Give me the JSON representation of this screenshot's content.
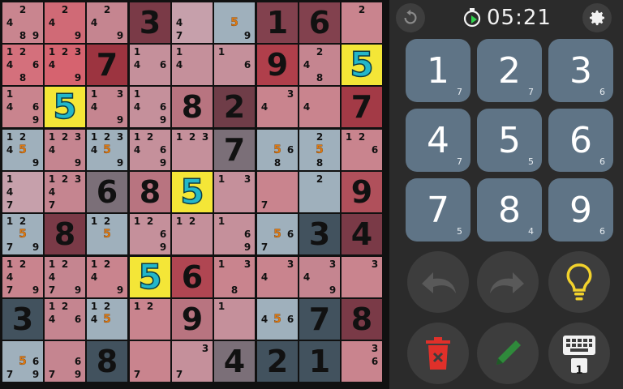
{
  "board": {
    "cells": [
      [
        {
          "n": "",
          "m": "2489",
          "c": "#c9858f"
        },
        {
          "n": "",
          "m": "249",
          "c": "#d06a76"
        },
        {
          "n": "",
          "m": "249",
          "c": "#c58590"
        },
        {
          "n": "3",
          "c": "#7a3a47"
        },
        {
          "n": "",
          "m": "47",
          "c": "#c6a0ab"
        },
        {
          "n": "",
          "m": "59",
          "c": "#9fb0bc"
        },
        {
          "n": "1",
          "c": "#82414e"
        },
        {
          "n": "6",
          "c": "#82414e"
        },
        {
          "n": "",
          "m": "2",
          "c": "#c9848e"
        }
      ],
      [
        {
          "n": "",
          "m": "12468",
          "c": "#d4707c"
        },
        {
          "n": "",
          "m": "12349",
          "c": "#d6636f"
        },
        {
          "n": "7",
          "c": "#9c3440"
        },
        {
          "n": "",
          "m": "146",
          "c": "#c5909b"
        },
        {
          "n": "",
          "m": "14",
          "c": "#c5909b"
        },
        {
          "n": "",
          "m": "16",
          "c": "#c5909b"
        },
        {
          "n": "9",
          "c": "#b03f4b"
        },
        {
          "n": "",
          "m": "248",
          "c": "#c58590"
        },
        {
          "n": "5",
          "c": "#f4e637",
          "hl": true
        }
      ],
      [
        {
          "n": "",
          "m": "1469",
          "c": "#c9848e"
        },
        {
          "n": "5",
          "c": "#f4e637",
          "hl": true
        },
        {
          "n": "",
          "m": "1349",
          "c": "#c58590"
        },
        {
          "n": "",
          "m": "1469",
          "c": "#c5909b"
        },
        {
          "n": "8",
          "c": "#b87480"
        },
        {
          "n": "2",
          "c": "#6f3d48"
        },
        {
          "n": "",
          "m": "34",
          "c": "#c9848e"
        },
        {
          "n": "",
          "m": "4",
          "c": "#c9848e"
        },
        {
          "n": "7",
          "c": "#a33a46"
        }
      ],
      [
        {
          "n": "",
          "m": "12459",
          "c": "#9fb0bc"
        },
        {
          "n": "",
          "m": "12349",
          "c": "#c58590"
        },
        {
          "n": "",
          "m": "123459",
          "c": "#9fb0bc"
        },
        {
          "n": "",
          "m": "12469",
          "c": "#c5909b"
        },
        {
          "n": "",
          "m": "123",
          "c": "#c5909b"
        },
        {
          "n": "7",
          "c": "#7b6f78"
        },
        {
          "n": "",
          "m": "568",
          "c": "#9fb0bc"
        },
        {
          "n": "",
          "m": "258",
          "c": "#9fb0bc"
        },
        {
          "n": "",
          "m": "126",
          "c": "#c9848e"
        }
      ],
      [
        {
          "n": "",
          "m": "147",
          "c": "#c6a0ab"
        },
        {
          "n": "",
          "m": "12347",
          "c": "#c58590"
        },
        {
          "n": "6",
          "c": "#7b6f78"
        },
        {
          "n": "8",
          "c": "#b87480"
        },
        {
          "n": "5",
          "c": "#f4e637",
          "hl": true
        },
        {
          "n": "",
          "m": "13",
          "c": "#c5909b"
        },
        {
          "n": "",
          "m": "7",
          "c": "#c9848e"
        },
        {
          "n": "",
          "m": "2",
          "c": "#9fb0bc"
        },
        {
          "n": "9",
          "c": "#b0505b"
        }
      ],
      [
        {
          "n": "",
          "m": "12579",
          "c": "#9fb0bc"
        },
        {
          "n": "8",
          "c": "#7a3a47"
        },
        {
          "n": "",
          "m": "125",
          "c": "#9fb0bc"
        },
        {
          "n": "",
          "m": "1269",
          "c": "#c5909b"
        },
        {
          "n": "",
          "m": "12",
          "c": "#c5909b"
        },
        {
          "n": "",
          "m": "169",
          "c": "#c5909b"
        },
        {
          "n": "",
          "m": "567",
          "c": "#9fb0bc"
        },
        {
          "n": "3",
          "c": "#42525e"
        },
        {
          "n": "4",
          "c": "#7a3a47"
        }
      ],
      [
        {
          "n": "",
          "m": "12479",
          "c": "#c9848e"
        },
        {
          "n": "",
          "m": "12479",
          "c": "#c58590"
        },
        {
          "n": "",
          "m": "1249",
          "c": "#c9848e"
        },
        {
          "n": "5",
          "c": "#f4e637",
          "hl": true
        },
        {
          "n": "6",
          "c": "#b04652"
        },
        {
          "n": "",
          "m": "138",
          "c": "#c9848e"
        },
        {
          "n": "",
          "m": "34",
          "c": "#c9848e"
        },
        {
          "n": "",
          "m": "349",
          "c": "#c58590"
        },
        {
          "n": "",
          "m": "3",
          "c": "#c9848e"
        }
      ],
      [
        {
          "n": "3",
          "c": "#42525e"
        },
        {
          "n": "",
          "m": "1246",
          "c": "#c58590"
        },
        {
          "n": "",
          "m": "1245",
          "c": "#9fb0bc"
        },
        {
          "n": "",
          "m": "12",
          "c": "#c9848e"
        },
        {
          "n": "9",
          "c": "#b87480"
        },
        {
          "n": "",
          "m": "1",
          "c": "#c5909b"
        },
        {
          "n": "",
          "m": "456",
          "c": "#9fb0bc"
        },
        {
          "n": "7",
          "c": "#42525e"
        },
        {
          "n": "8",
          "c": "#7a3a47"
        }
      ],
      [
        {
          "n": "",
          "m": "5679",
          "c": "#9fb0bc"
        },
        {
          "n": "",
          "m": "679",
          "c": "#c58590"
        },
        {
          "n": "8",
          "c": "#42525e"
        },
        {
          "n": "",
          "m": "7",
          "c": "#c9848e"
        },
        {
          "n": "",
          "m": "37",
          "c": "#c5909b"
        },
        {
          "n": "4",
          "c": "#7b6f78"
        },
        {
          "n": "2",
          "c": "#42525e"
        },
        {
          "n": "1",
          "c": "#42525e"
        },
        {
          "n": "",
          "m": "36",
          "c": "#c9848e"
        }
      ]
    ]
  },
  "timer": {
    "value": "05:21"
  },
  "icons": {
    "reset": "reset-icon",
    "settings": "gear-icon",
    "timer": "stopwatch-icon",
    "undo": "undo-icon",
    "redo": "redo-icon",
    "hint": "lightbulb-icon",
    "erase": "trash-icon",
    "pencil": "pencil-icon",
    "keyboard": "keyboard-icon"
  },
  "keypad": [
    {
      "num": "1",
      "count": "7"
    },
    {
      "num": "2",
      "count": "7"
    },
    {
      "num": "3",
      "count": "6"
    },
    {
      "num": "4",
      "count": "7"
    },
    {
      "num": "5",
      "count": "5"
    },
    {
      "num": "6",
      "count": "6"
    },
    {
      "num": "7",
      "count": "5"
    },
    {
      "num": "8",
      "count": "4"
    },
    {
      "num": "9",
      "count": "6"
    }
  ],
  "keyboard_badge": "1",
  "colors": {
    "key": "#5f7486",
    "highlight": "#f4e637",
    "accent_timer": "#2fd14a",
    "hint": "#f2d22c",
    "erase": "#e0302a",
    "pencil": "#2f8a3b"
  }
}
